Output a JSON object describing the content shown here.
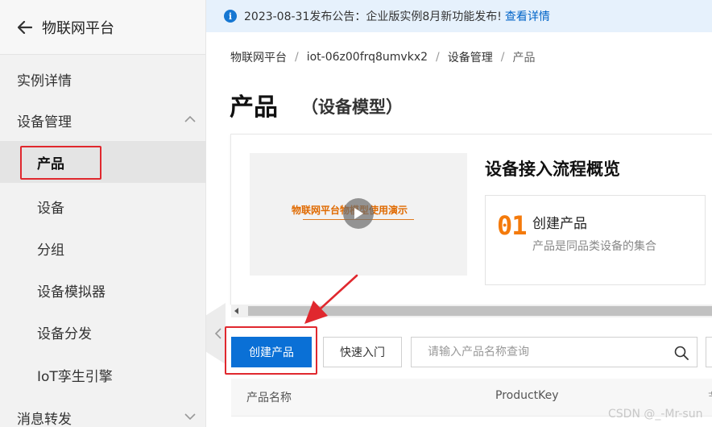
{
  "sidebar": {
    "back_label": "物联网平台",
    "items": [
      {
        "label": "实例详情"
      },
      {
        "label": "设备管理"
      },
      {
        "label": "产品"
      },
      {
        "label": "设备"
      },
      {
        "label": "分组"
      },
      {
        "label": "设备模拟器"
      },
      {
        "label": "设备分发"
      },
      {
        "label": "IoT孪生引擎"
      },
      {
        "label": "消息转发"
      }
    ]
  },
  "notice": {
    "text": "2023-08-31发布公告：企业版实例8月新功能发布!",
    "link": "查看详情"
  },
  "breadcrumb": [
    "物联网平台",
    "iot-06z00frq8umvkx2",
    "设备管理",
    "产品"
  ],
  "page": {
    "title": "产品",
    "subtitle": "（设备模型）"
  },
  "overview": {
    "video_text": "物联网平台物模型使用演示",
    "flow_title": "设备接入流程概览",
    "step": {
      "num": "01",
      "name": "创建产品",
      "desc": "产品是同品类设备的集合"
    }
  },
  "toolbar": {
    "create_label": "创建产品",
    "quickstart_label": "快速入门",
    "search_placeholder": "请输入产品名称查询"
  },
  "table": {
    "columns": [
      "产品名称",
      "ProductKey",
      "节"
    ]
  },
  "watermark": "CSDN @_-Mr-sun",
  "colors": {
    "primary": "#0a70d6",
    "highlight": "#e0282e",
    "accent_orange": "#f47a0b",
    "notice_bg": "#e6f1fc"
  }
}
